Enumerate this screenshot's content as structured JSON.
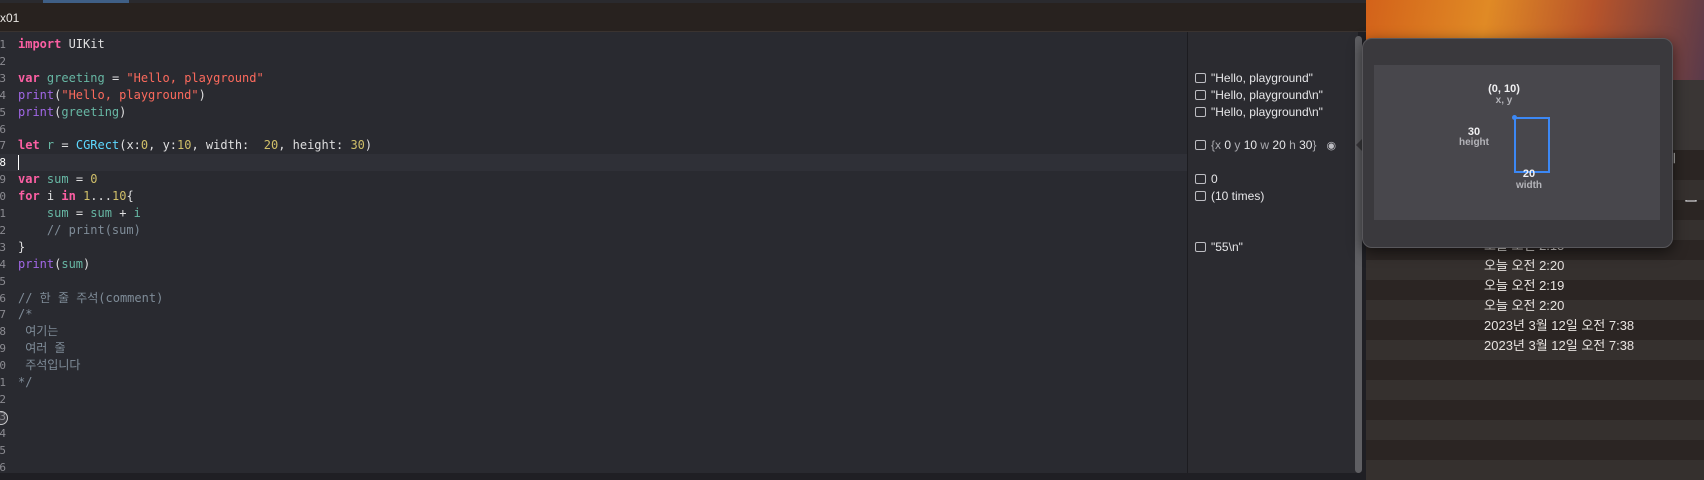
{
  "tab": {
    "title": "x01"
  },
  "editor": {
    "lines": [
      {
        "n": "1",
        "tokens": [
          [
            "kw",
            "import"
          ],
          [
            "ident",
            " UIKit"
          ]
        ]
      },
      {
        "n": "2",
        "tokens": []
      },
      {
        "n": "3",
        "tokens": [
          [
            "kw",
            "var"
          ],
          [
            "ident",
            " "
          ],
          [
            "var",
            "greeting"
          ],
          [
            "ident",
            " = "
          ],
          [
            "str",
            "\"Hello, playground\""
          ]
        ]
      },
      {
        "n": "4",
        "tokens": [
          [
            "fn",
            "print"
          ],
          [
            "ident",
            "("
          ],
          [
            "str",
            "\"Hello, playground\""
          ],
          [
            "ident",
            ")"
          ]
        ]
      },
      {
        "n": "5",
        "tokens": [
          [
            "fn",
            "print"
          ],
          [
            "ident",
            "("
          ],
          [
            "var",
            "greeting"
          ],
          [
            "ident",
            ")"
          ]
        ]
      },
      {
        "n": "6",
        "tokens": []
      },
      {
        "n": "7",
        "tokens": [
          [
            "kw",
            "let"
          ],
          [
            "ident",
            " "
          ],
          [
            "var",
            "r"
          ],
          [
            "ident",
            " = "
          ],
          [
            "ty",
            "CGRect"
          ],
          [
            "ident",
            "("
          ],
          [
            "ident",
            "x:"
          ],
          [
            "num",
            "0"
          ],
          [
            "ident",
            ", y:"
          ],
          [
            "num",
            "10"
          ],
          [
            "ident",
            ", width:  "
          ],
          [
            "num",
            "20"
          ],
          [
            "ident",
            ", height: "
          ],
          [
            "num",
            "30"
          ],
          [
            "ident",
            ")"
          ]
        ]
      },
      {
        "n": "8",
        "tokens": [],
        "current": true
      },
      {
        "n": "9",
        "tokens": [
          [
            "kw",
            "var"
          ],
          [
            "ident",
            " "
          ],
          [
            "var",
            "sum"
          ],
          [
            "ident",
            " = "
          ],
          [
            "num",
            "0"
          ]
        ]
      },
      {
        "n": "0",
        "tokens": [
          [
            "kw",
            "for"
          ],
          [
            "ident",
            " i "
          ],
          [
            "kw",
            "in"
          ],
          [
            "ident",
            " "
          ],
          [
            "num",
            "1"
          ],
          [
            "ident",
            "..."
          ],
          [
            "num",
            "10"
          ],
          [
            "ident",
            "{"
          ]
        ]
      },
      {
        "n": "1",
        "tokens": [
          [
            "ident",
            "    "
          ],
          [
            "var",
            "sum"
          ],
          [
            "ident",
            " = "
          ],
          [
            "var",
            "sum"
          ],
          [
            "ident",
            " + "
          ],
          [
            "var",
            "i"
          ]
        ]
      },
      {
        "n": "2",
        "tokens": [
          [
            "cm",
            "    // print(sum)"
          ]
        ]
      },
      {
        "n": "3",
        "tokens": [
          [
            "ident",
            "}"
          ]
        ]
      },
      {
        "n": "4",
        "tokens": [
          [
            "fn",
            "print"
          ],
          [
            "ident",
            "("
          ],
          [
            "var",
            "sum"
          ],
          [
            "ident",
            ")"
          ]
        ]
      },
      {
        "n": "5",
        "tokens": []
      },
      {
        "n": "6",
        "tokens": [
          [
            "cm",
            "// 한 줄 주석(comment)"
          ]
        ]
      },
      {
        "n": "7",
        "tokens": [
          [
            "cm",
            "/*"
          ]
        ]
      },
      {
        "n": "8",
        "tokens": [
          [
            "cm",
            " 여기는"
          ]
        ]
      },
      {
        "n": "9",
        "tokens": [
          [
            "cm",
            " 여러 줄"
          ]
        ]
      },
      {
        "n": "0",
        "tokens": [
          [
            "cm",
            " 주석입니다"
          ]
        ]
      },
      {
        "n": "1",
        "tokens": [
          [
            "cm",
            "*/"
          ]
        ]
      },
      {
        "n": "2",
        "tokens": []
      },
      {
        "n": "3",
        "tokens": []
      },
      {
        "n": "4",
        "tokens": []
      },
      {
        "n": "5",
        "tokens": []
      },
      {
        "n": "6",
        "tokens": []
      }
    ]
  },
  "results": [
    {
      "line": 3,
      "text": "\"Hello, playground\""
    },
    {
      "line": 4,
      "text": "\"Hello, playground\\n\""
    },
    {
      "line": 5,
      "text": "\"Hello, playground\\n\""
    },
    {
      "line": 7,
      "rect": [
        "{x ",
        "0",
        " y ",
        "10",
        " w ",
        "20",
        " h ",
        "30",
        "}"
      ]
    },
    {
      "line": 9,
      "text": "0"
    },
    {
      "line": 10,
      "text": "(10 times)"
    },
    {
      "line": 13,
      "text": "\"55\\n\""
    }
  ],
  "quicklook": {
    "origin_label": "(0, 10)",
    "origin_sub": "x, y",
    "height_value": "30",
    "height_label": "height",
    "width_value": "20",
    "width_label": "width",
    "accent_color": "#3c88f4"
  },
  "finder": {
    "column_header": "기",
    "rows": [
      "오늘 오전 2:15",
      "오늘 오전 2:20",
      "오늘 오전 2:19",
      "오늘 오전 2:20",
      "2023년 3월 12일 오전 7:38",
      "2023년 3월 12일 오전 7:38"
    ]
  }
}
